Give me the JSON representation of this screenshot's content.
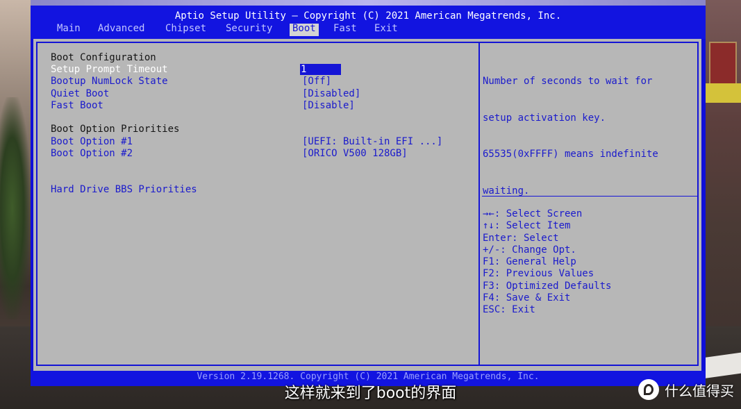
{
  "title": "Aptio Setup Utility – Copyright (C) 2021 American Megatrends, Inc.",
  "menu": [
    {
      "label": "Main",
      "active": false
    },
    {
      "label": "Advanced",
      "active": false
    },
    {
      "label": "Chipset",
      "active": false
    },
    {
      "label": "Security",
      "active": false
    },
    {
      "label": "Boot",
      "active": true
    },
    {
      "label": "Fast",
      "active": false
    },
    {
      "label": "Exit",
      "active": false
    }
  ],
  "settings": {
    "boot_configuration_header": "Boot Configuration",
    "setup_prompt_timeout": {
      "label": "Setup Prompt Timeout",
      "value": "1"
    },
    "bootup_numlock_state": {
      "label": "Bootup NumLock State",
      "value": "[Off]"
    },
    "quiet_boot": {
      "label": "Quiet Boot",
      "value": "[Disabled]"
    },
    "fast_boot": {
      "label": "Fast Boot",
      "value": "[Disable]"
    },
    "boot_option_priorities_header": "Boot Option Priorities",
    "boot_option_1": {
      "label": "Boot Option #1",
      "value": "[UEFI: Built-in EFI ...]"
    },
    "boot_option_2": {
      "label": "Boot Option #2",
      "value": "[ORICO V500 128GB]"
    },
    "hard_drive_bbs": {
      "label": "Hard Drive BBS Priorities"
    }
  },
  "help": {
    "lines": [
      "Number of seconds to wait for",
      "setup activation key.",
      "65535(0xFFFF) means indefinite",
      "waiting."
    ]
  },
  "keys": [
    "→←: Select Screen",
    "↑↓: Select Item",
    "Enter: Select",
    "+/-: Change Opt.",
    "F1: General Help",
    "F2: Previous Values",
    "F3: Optimized Defaults",
    "F4: Save & Exit",
    "ESC: Exit"
  ],
  "footer": "Version 2.19.1268. Copyright (C) 2021 American Megatrends, Inc.",
  "subtitle": "这样就来到了boot的界面",
  "watermark": {
    "text": "什么值得买",
    "icon": "zhi-logo-icon"
  },
  "colors": {
    "bios_blue": "#1414d6",
    "panel_gray": "#b7b7b7",
    "title_text": "#ffffff"
  }
}
